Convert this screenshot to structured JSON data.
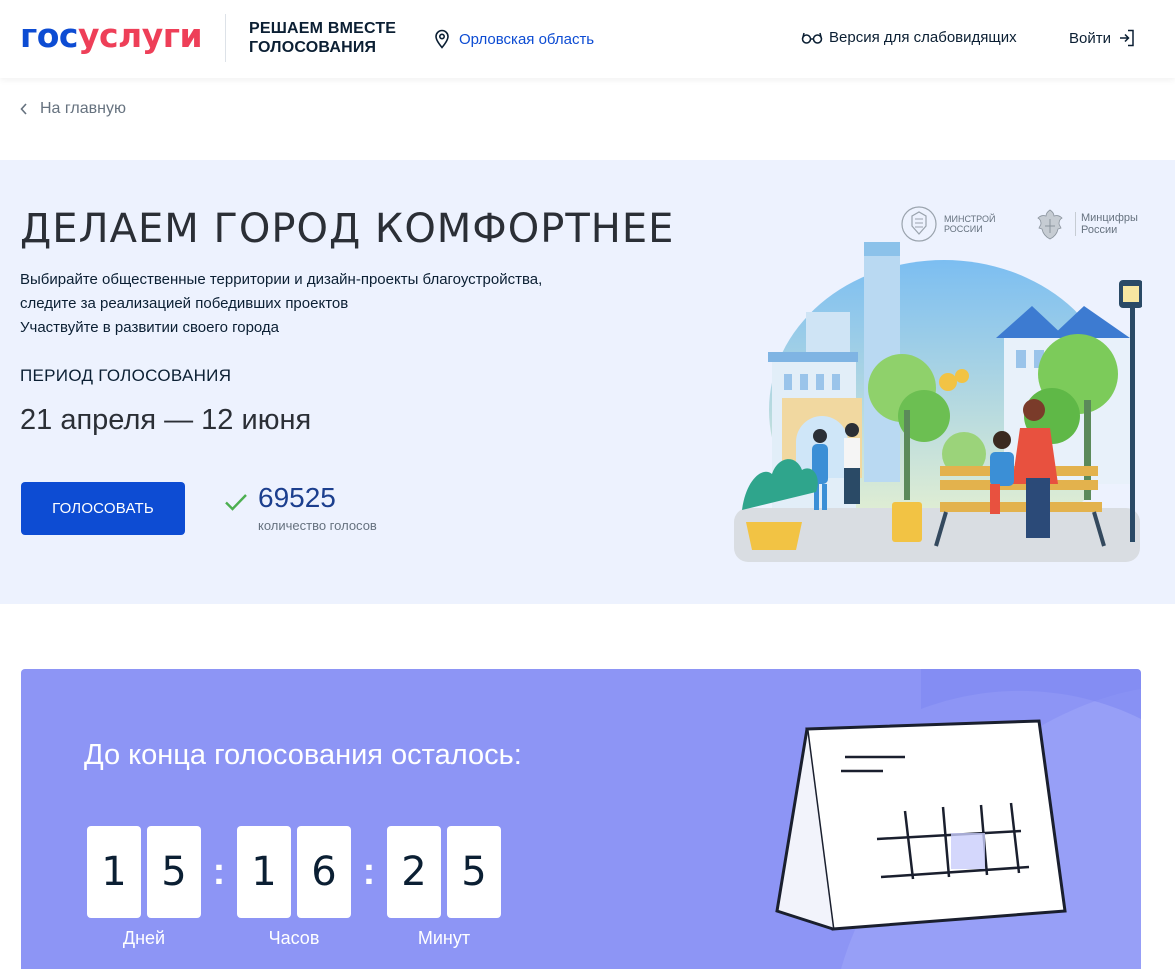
{
  "header": {
    "logo_part1": "гос",
    "logo_part2": "услуги",
    "tagline_line1": "РЕШАЕМ ВМЕСТЕ",
    "tagline_line2": "ГОЛОСОВАНИЯ",
    "region": "Орловская область",
    "a11y_label": "Версия для слабовидящих",
    "login_label": "Войти"
  },
  "breadcrumb": {
    "back_label": "На главную"
  },
  "hero": {
    "title": "ДЕЛАЕМ ГОРОД КОМФОРТНЕЕ",
    "desc_line1": "Выбирайте общественные территории и дизайн-проекты благоустройства,",
    "desc_line2": "следите за реализацией победивших проектов",
    "desc_line3": "Участвуйте в развитии своего города",
    "period_label": "ПЕРИОД ГОЛОСОВАНИЯ",
    "period": "21 апреля — 12 июня",
    "vote_button": "ГОЛОСОВАТЬ",
    "vote_count": "69525",
    "vote_count_label": "количество голосов",
    "partners": [
      {
        "line1": "МИНСТРОЙ",
        "line2": "РОССИИ"
      },
      {
        "line1": "Минцифры",
        "line2": "России"
      }
    ]
  },
  "countdown": {
    "title": "До конца голосования осталось:",
    "groups": [
      {
        "d1": "1",
        "d2": "5",
        "unit": "Дней"
      },
      {
        "d1": "1",
        "d2": "6",
        "unit": "Часов"
      },
      {
        "d1": "2",
        "d2": "5",
        "unit": "Минут"
      }
    ],
    "separator": ":"
  },
  "colors": {
    "brand_blue": "#0d4cd3",
    "brand_red": "#ee3f58",
    "hero_bg": "#edf2fe",
    "countdown_bg": "#8d95f5",
    "check_green": "#4caf50"
  },
  "icons": [
    "location-pin-icon",
    "glasses-icon",
    "login-arrow-icon",
    "chevron-left-icon",
    "check-icon",
    "emblem-icon"
  ]
}
